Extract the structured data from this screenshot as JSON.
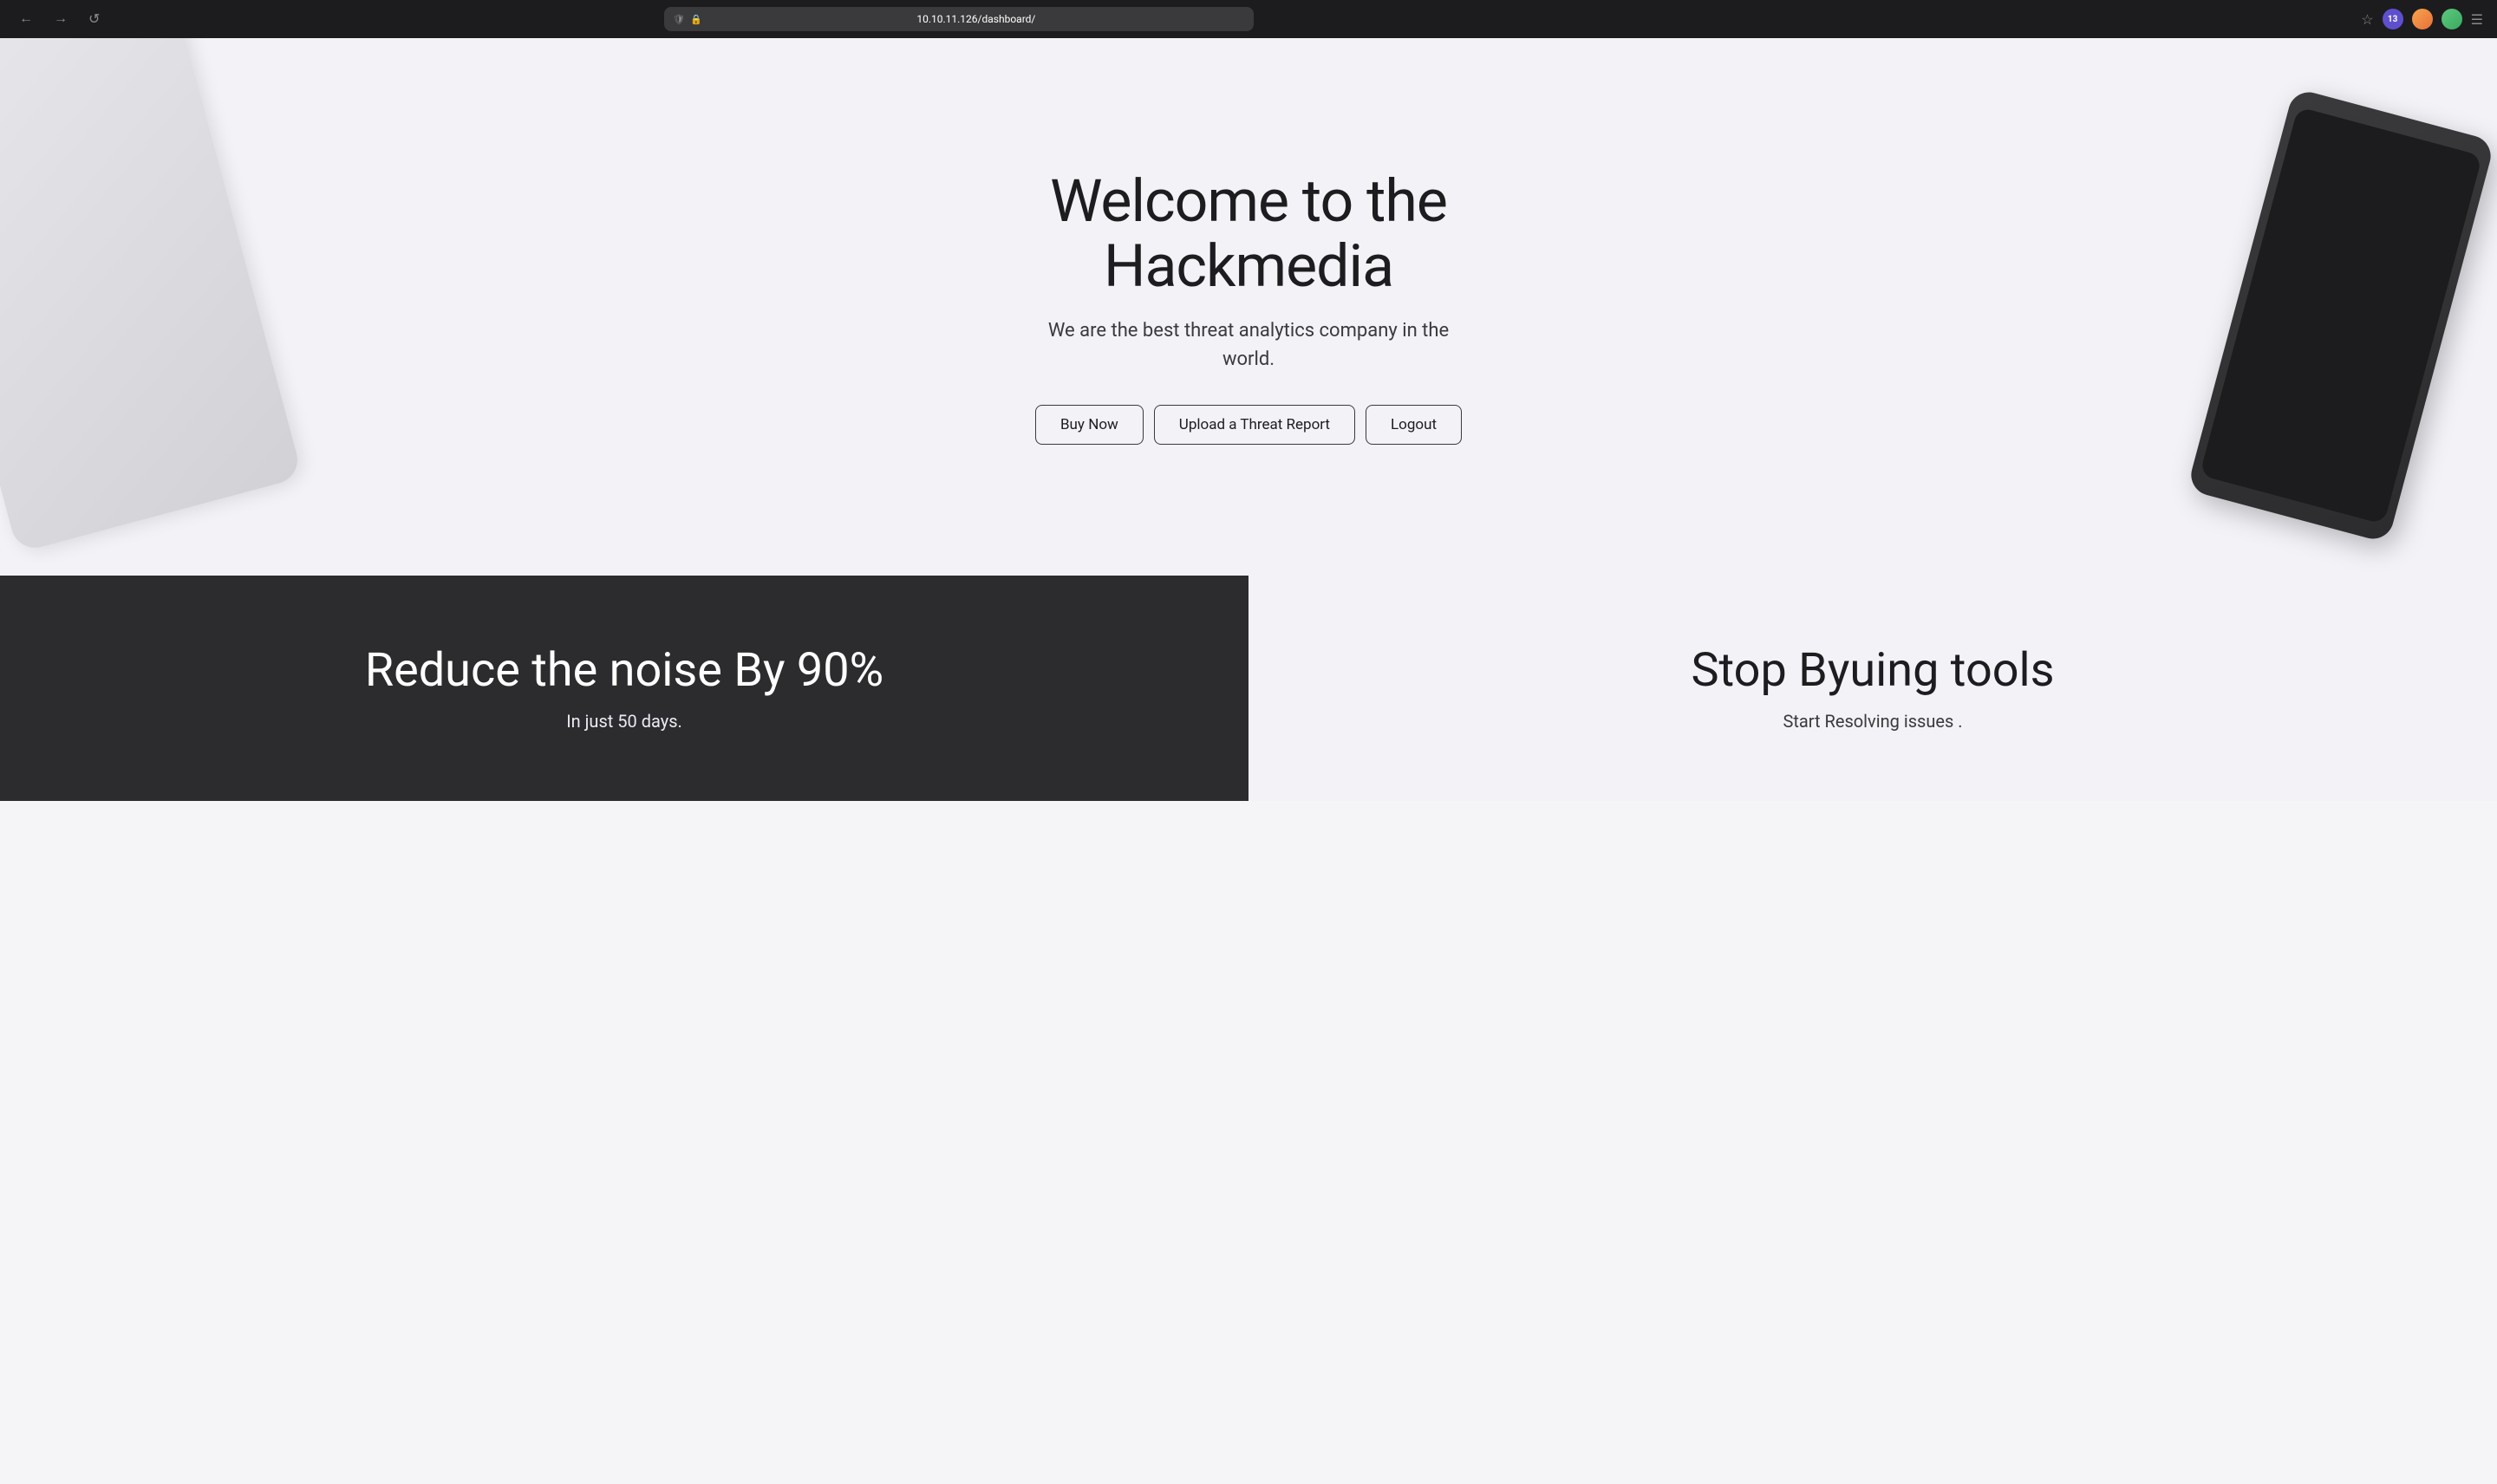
{
  "browser": {
    "url": "10.10.11.126/dashboard/",
    "back_btn": "←",
    "forward_btn": "→",
    "refresh_btn": "↺"
  },
  "hero": {
    "title_line1": "Welcome to the",
    "title_line2": "Hackmedia",
    "subtitle": "We are the best threat analytics company in the world.",
    "btn_buy_now": "Buy Now",
    "btn_upload": "Upload a Threat Report",
    "btn_logout": "Logout"
  },
  "dark_card": {
    "title": "Reduce the noise By 90%",
    "subtitle": "In just 50 days."
  },
  "light_card": {
    "title": "Stop Byuing tools",
    "subtitle": "Start Resolving issues ."
  }
}
